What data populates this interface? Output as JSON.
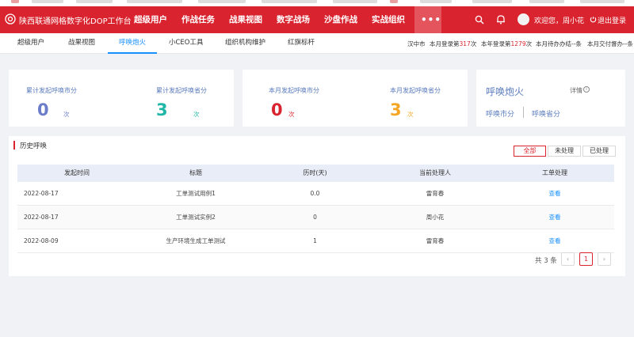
{
  "colors": {
    "brand_red": "#d9242f",
    "link_blue": "#1890ff",
    "teal": "#1fb5a7",
    "orange": "#f5a623",
    "soft_blue": "#6b7cc8"
  },
  "header": {
    "app_title": "陕西联通网格数字化DOP工作台",
    "nav": [
      "超级用户",
      "作战任务",
      "战果视图",
      "数字战场",
      "沙盘作战",
      "实战组织"
    ],
    "more": "•••",
    "welcome": "欢迎您，周小花",
    "logout": "退出登录",
    "icons": [
      "unicom-logo-icon",
      "search-icon",
      "bell-icon",
      "avatar",
      "logout-icon"
    ]
  },
  "subnav": {
    "tabs": [
      "超级用户",
      "战果视图",
      "呼唤炮火",
      "小CEO工具",
      "组织机构维护",
      "红旗标杆"
    ],
    "active_index": 2,
    "stats": {
      "region": "汉中市",
      "month_login_pre": "本月登录第",
      "month_login_num": "317",
      "month_login_suf": "次",
      "year_login_pre": "本年登录第",
      "year_login_num": "1279",
      "year_login_suf": "次",
      "todo": "本月待办办结--条",
      "delivery": "本月交付督办--条"
    }
  },
  "cards": {
    "total_city": {
      "label": "累计发起呼唤市分",
      "value": "0",
      "unit": "次"
    },
    "total_prov": {
      "label": "累计发起呼唤省分",
      "value": "3",
      "unit": "次"
    },
    "month_city": {
      "label": "本月发起呼唤市分",
      "value": "0",
      "unit": "次"
    },
    "month_prov": {
      "label": "本月发起呼唤省分",
      "value": "3",
      "unit": "次"
    },
    "call_fire": {
      "title": "呼唤炮火",
      "detail": "详情",
      "info_glyph": "i",
      "city_link": "呼唤市分",
      "prov_link": "呼唤省分"
    }
  },
  "history": {
    "title": "历史呼唤",
    "filters": [
      "全部",
      "未处理",
      "已处理"
    ],
    "active_filter": 0,
    "columns": [
      "发起时间",
      "标题",
      "历时(天)",
      "当前处理人",
      "工单处理"
    ],
    "rows": [
      {
        "date": "2022-08-17",
        "title": "工单测试用例1",
        "days": "0.0",
        "handler": "雷育春",
        "action": "查看"
      },
      {
        "date": "2022-08-17",
        "title": "工单测试实例2",
        "days": "0",
        "handler": "周小花",
        "action": "查看"
      },
      {
        "date": "2022-08-09",
        "title": "生产环境生成工单测试",
        "days": "1",
        "handler": "雷育春",
        "action": "查看"
      }
    ],
    "pagination": {
      "total": "共 3 条",
      "prev": "‹",
      "page": "1",
      "next": "›"
    }
  }
}
